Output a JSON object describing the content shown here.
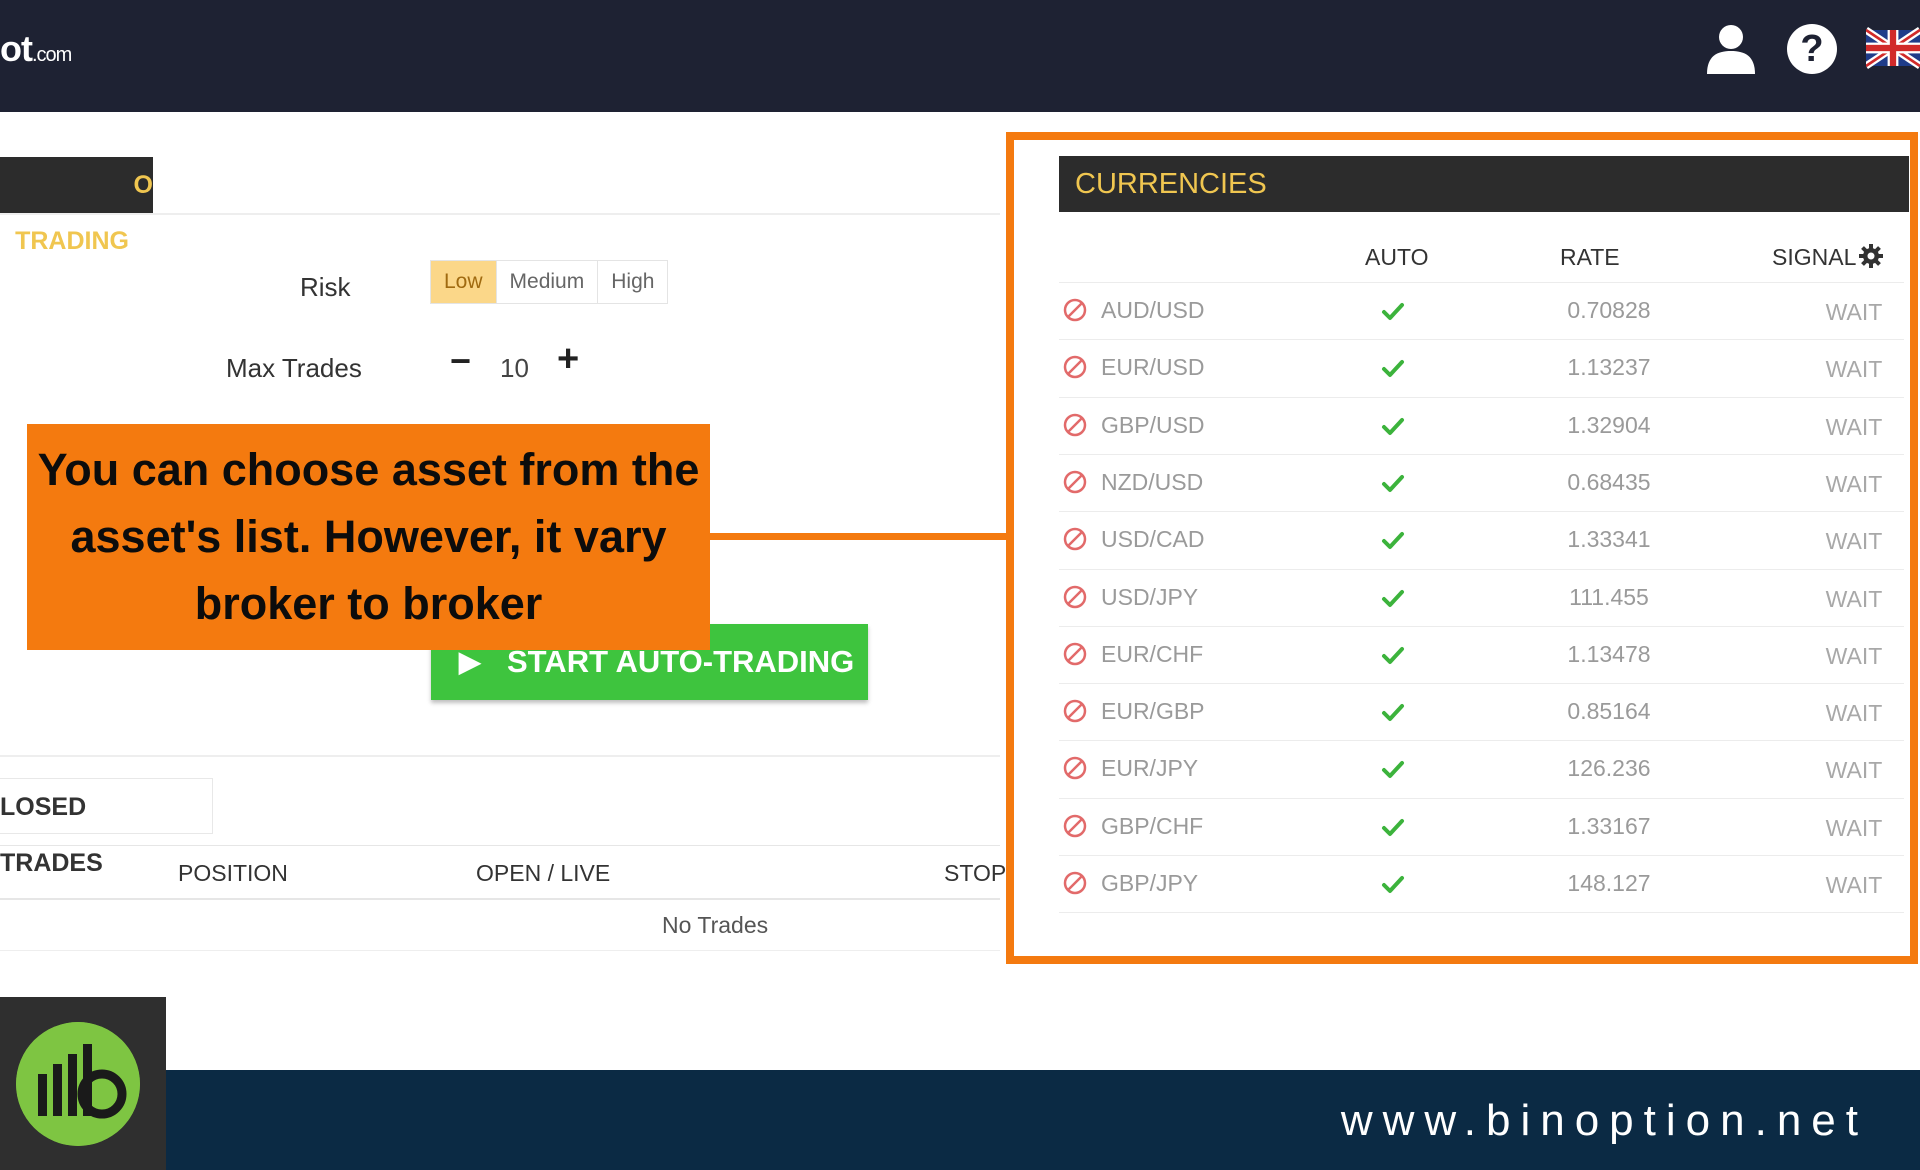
{
  "header": {
    "logo_text": "ot",
    "logo_suffix": ".com"
  },
  "auto_trading": {
    "tab_label": "O TRADING",
    "risk_label": "Risk",
    "risk_options": [
      "Low",
      "Medium",
      "High"
    ],
    "risk_selected": "Low",
    "max_trades_label": "Max Trades",
    "max_trades_value": "10",
    "start_button": "START AUTO-TRADING"
  },
  "closed_trades": {
    "tab_label": "LOSED TRADES",
    "columns": [
      "POSITION",
      "OPEN / LIVE",
      "STOP"
    ],
    "empty_text": "No Trades"
  },
  "callout": {
    "text": "You can choose asset from the asset's list. However, it vary broker to broker"
  },
  "currencies": {
    "title": "CURRENCIES",
    "columns": [
      "AUTO",
      "RATE",
      "SIGNAL"
    ],
    "rows": [
      {
        "pair": "AUD/USD",
        "rate": "0.70828",
        "signal": "WAIT"
      },
      {
        "pair": "EUR/USD",
        "rate": "1.13237",
        "signal": "WAIT"
      },
      {
        "pair": "GBP/USD",
        "rate": "1.32904",
        "signal": "WAIT"
      },
      {
        "pair": "NZD/USD",
        "rate": "0.68435",
        "signal": "WAIT"
      },
      {
        "pair": "USD/CAD",
        "rate": "1.33341",
        "signal": "WAIT"
      },
      {
        "pair": "USD/JPY",
        "rate": "111.455",
        "signal": "WAIT"
      },
      {
        "pair": "EUR/CHF",
        "rate": "1.13478",
        "signal": "WAIT"
      },
      {
        "pair": "EUR/GBP",
        "rate": "0.85164",
        "signal": "WAIT"
      },
      {
        "pair": "EUR/JPY",
        "rate": "126.236",
        "signal": "WAIT"
      },
      {
        "pair": "GBP/CHF",
        "rate": "1.33167",
        "signal": "WAIT"
      },
      {
        "pair": "GBP/JPY",
        "rate": "148.127",
        "signal": "WAIT"
      }
    ]
  },
  "footer": {
    "url": "www.binoption.net"
  },
  "colors": {
    "accent_orange": "#f47a0f",
    "start_green": "#3ec43e",
    "tab_gold": "#f0c650",
    "topbar": "#1e2233",
    "footer": "#0b2a44"
  }
}
